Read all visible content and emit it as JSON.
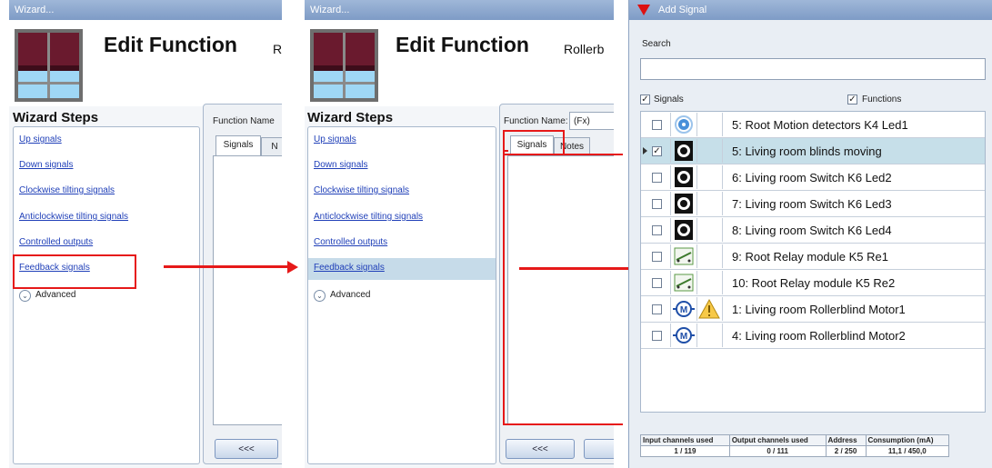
{
  "wizard_left": {
    "window_title": "Wizard...",
    "header_title": "Edit Function",
    "header_sub": "R",
    "steps_title": "Wizard Steps",
    "steps": [
      "Up signals",
      "Down signals",
      "Clockwise tilting signals",
      "Anticlockwise tilting signals",
      "Controlled outputs",
      "Feedback signals"
    ],
    "advanced_label": "Advanced",
    "function_name_label": "Function Name",
    "tab_signals": "Signals",
    "tab_notes": "N",
    "back_button": "<<<"
  },
  "wizard_mid": {
    "window_title": "Wizard...",
    "header_title": "Edit Function",
    "header_sub": "Rollerb",
    "steps_title": "Wizard Steps",
    "steps": [
      "Up signals",
      "Down signals",
      "Clockwise tilting signals",
      "Anticlockwise tilting signals",
      "Controlled outputs",
      "Feedback signals"
    ],
    "advanced_label": "Advanced",
    "function_name_label": "Function Name:",
    "function_name_value": "(Fx)",
    "tab_signals": "Signals",
    "tab_notes": "Notes",
    "back_button": "<<<"
  },
  "add_signal": {
    "window_title": "Add Signal",
    "search_label": "Search",
    "search_value": "",
    "filter_signals_label": "Signals",
    "filter_functions_label": "Functions",
    "rows": [
      {
        "icon": "motion-detector-icon",
        "name": "5: Root Motion detectors K4 Led1",
        "checked": false,
        "selected": false,
        "warning": false
      },
      {
        "icon": "switch-icon",
        "name": "5: Living room blinds moving",
        "checked": true,
        "selected": true,
        "warning": false
      },
      {
        "icon": "switch-icon",
        "name": "6: Living room Switch K6 Led2",
        "checked": false,
        "selected": false,
        "warning": false
      },
      {
        "icon": "switch-icon",
        "name": "7: Living room Switch K6 Led3",
        "checked": false,
        "selected": false,
        "warning": false
      },
      {
        "icon": "switch-icon",
        "name": "8: Living room Switch K6 Led4",
        "checked": false,
        "selected": false,
        "warning": false
      },
      {
        "icon": "relay-icon",
        "name": "9: Root Relay module K5 Re1",
        "checked": false,
        "selected": false,
        "warning": false
      },
      {
        "icon": "relay-icon",
        "name": "10: Root Relay module K5 Re2",
        "checked": false,
        "selected": false,
        "warning": false
      },
      {
        "icon": "motor-icon",
        "name": "1: Living room Rollerblind  Motor1",
        "checked": false,
        "selected": false,
        "warning": true
      },
      {
        "icon": "motor-icon",
        "name": "4: Living room Rollerblind  Motor2",
        "checked": false,
        "selected": false,
        "warning": false
      }
    ],
    "stats": {
      "headers": [
        "Input channels used",
        "Output channels used",
        "Address",
        "Consumption (mA)"
      ],
      "values": [
        "1 / 119",
        "0 / 111",
        "2 / 250",
        "11,1 / 450,0"
      ]
    }
  },
  "colors": {
    "highlight": "#e61919",
    "selected_row": "#c6dfe9",
    "link": "#1f3fb8"
  }
}
